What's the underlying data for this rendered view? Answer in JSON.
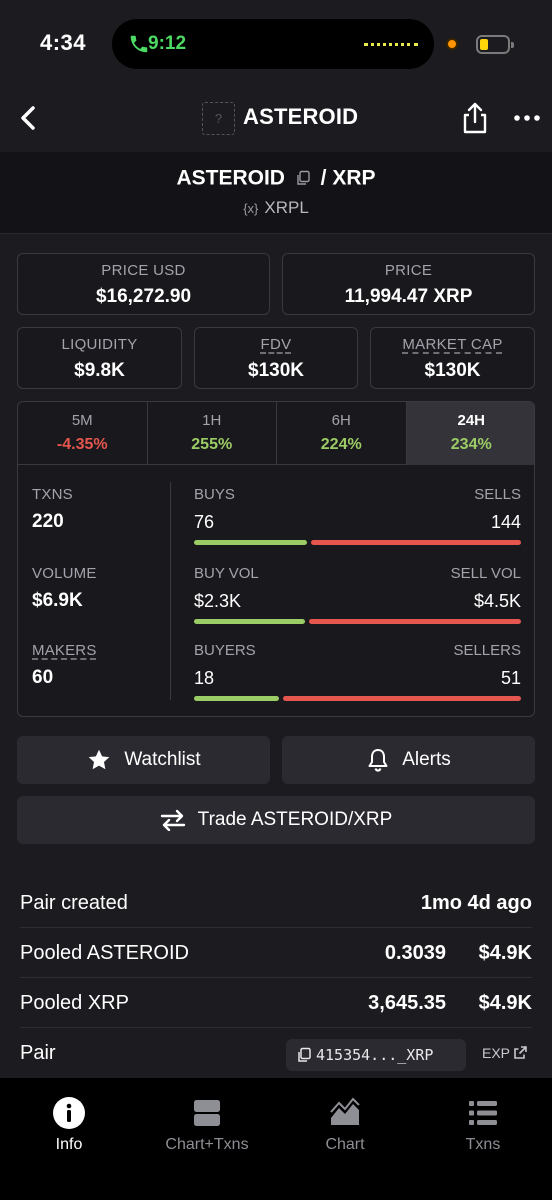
{
  "status_bar": {
    "time": "4:34",
    "call_time": "9:12"
  },
  "nav": {
    "title": "ASTEROID",
    "avatar_placeholder": "?"
  },
  "pair": {
    "base": "ASTEROID",
    "separator": "/",
    "quote": "XRP",
    "chain_icon": "{x}",
    "chain": "XRPL"
  },
  "price_boxes": [
    {
      "label": "PRICE USD",
      "value": "$16,272.90"
    },
    {
      "label": "PRICE",
      "value": "11,994.47 XRP"
    }
  ],
  "market_boxes": [
    {
      "label": "LIQUIDITY",
      "value": "$9.8K"
    },
    {
      "label": "FDV",
      "value": "$130K"
    },
    {
      "label": "MARKET CAP",
      "value": "$130K"
    }
  ],
  "timeframes": [
    {
      "label": "5M",
      "value": "-4.35%",
      "direction": "down"
    },
    {
      "label": "1H",
      "value": "255%",
      "direction": "up"
    },
    {
      "label": "6H",
      "value": "224%",
      "direction": "up"
    },
    {
      "label": "24H",
      "value": "234%",
      "direction": "up",
      "active": true
    }
  ],
  "stats": {
    "txns": {
      "label": "TXNS",
      "value": "220"
    },
    "volume": {
      "label": "VOLUME",
      "value": "$6.9K"
    },
    "makers": {
      "label": "MAKERS",
      "value": "60"
    }
  },
  "metrics": [
    {
      "left_label": "BUYS",
      "right_label": "SELLS",
      "left_value": "76",
      "right_value": "144",
      "buy_fraction": 0.345
    },
    {
      "left_label": "BUY VOL",
      "right_label": "SELL VOL",
      "left_value": "$2.3K",
      "right_value": "$4.5K",
      "buy_fraction": 0.338
    },
    {
      "left_label": "BUYERS",
      "right_label": "SELLERS",
      "left_value": "18",
      "right_value": "51",
      "buy_fraction": 0.261
    }
  ],
  "buttons": {
    "watchlist": "Watchlist",
    "alerts": "Alerts",
    "trade": "Trade ASTEROID/XRP"
  },
  "info": {
    "pair_created": {
      "label": "Pair created",
      "value": "1mo 4d ago"
    },
    "pooled_base": {
      "label": "Pooled ASTEROID",
      "amount": "0.3039",
      "usd": "$4.9K"
    },
    "pooled_quote": {
      "label": "Pooled XRP",
      "amount": "3,645.35",
      "usd": "$4.9K"
    },
    "pair_address": {
      "label": "Pair",
      "value": "415354..._XRP",
      "explorer": "EXP"
    }
  },
  "tabbar": [
    {
      "label": "Info",
      "icon": "info-icon",
      "active": true
    },
    {
      "label": "Chart+Txns",
      "icon": "split-view-icon"
    },
    {
      "label": "Chart",
      "icon": "area-chart-icon"
    },
    {
      "label": "Txns",
      "icon": "list-icon"
    }
  ],
  "colors": {
    "positive": "#9ccc65",
    "negative": "#e5564e",
    "background": "#1c1b20"
  }
}
